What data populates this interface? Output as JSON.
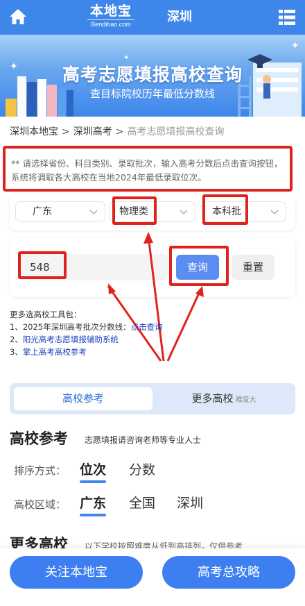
{
  "header": {
    "logo_text": "本地宝",
    "logo_sub": "Bendibao.com",
    "city": "深圳"
  },
  "banner": {
    "title": "高考志愿填报高校查询",
    "subtitle": "查目标院校历年最低分数线"
  },
  "breadcrumb": {
    "items": [
      "深圳本地宝",
      "深圳高考",
      "高考志愿填报高校查询"
    ],
    "separator": ">"
  },
  "notice": "** 请选择省份、科目类别、录取批次，输入高考分数后点击查询按钮，系统将调取各大高校在当地2024年最低录取位次。",
  "filters": {
    "province": "广东",
    "subject": "物理类",
    "batch": "本科批"
  },
  "query": {
    "score_value": "548",
    "query_label": "查询",
    "reset_label": "重置"
  },
  "tools": {
    "heading": "更多选高校工具包：",
    "item1_prefix": "1、2025年深圳高考批次分数线：",
    "item1_link": "点击查询",
    "item2_prefix": "2、",
    "item2_link": "阳光高考志愿填报辅助系统",
    "item3_prefix": "3、",
    "item3_link": "掌上高考高校参考"
  },
  "tabs": {
    "tab1": "高校参考",
    "tab2": "更多高校",
    "tab2_note": "难度大"
  },
  "section": {
    "title": "高校参考",
    "desc": "志愿填报请咨询老师等专业人士",
    "sort_label": "排序方式：",
    "sort_options": [
      "位次",
      "分数"
    ],
    "region_label": "高校区域：",
    "region_options": [
      "广东",
      "全国",
      "深圳"
    ]
  },
  "more": {
    "title": "更多高校",
    "desc": "以下学校按照难度从低到高排列，仅供参考"
  },
  "bottom": {
    "follow_label": "关注本地宝",
    "guide_label": "高考总攻略"
  },
  "colors": {
    "primary": "#3f86ea",
    "highlight": "#e0221c",
    "query_button": "#5b8df0"
  }
}
